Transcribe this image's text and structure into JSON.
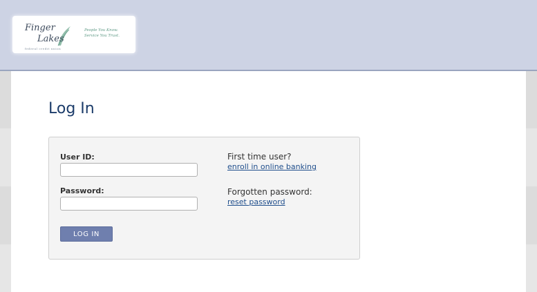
{
  "header": {
    "logo": {
      "name_line1": "Finger",
      "name_line2": "Lakes",
      "subtitle": "federal credit union",
      "tagline_line1": "People You Know.",
      "tagline_line2": "Service You Trust.",
      "leaf_color": "#7fb39c"
    },
    "background_color": "#cdd3e4"
  },
  "page": {
    "title": "Log In",
    "title_color": "#1c3c6a"
  },
  "login_form": {
    "user_id_label": "User ID:",
    "user_id_value": "",
    "password_label": "Password:",
    "password_value": "",
    "submit_label": "LOG IN",
    "button_color": "#6f7fae"
  },
  "help": {
    "first_time_text": "First time user?",
    "enroll_link": "enroll in online banking",
    "forgot_text": "Forgotten password:",
    "reset_link": "reset password",
    "link_color": "#1f4e8c"
  }
}
